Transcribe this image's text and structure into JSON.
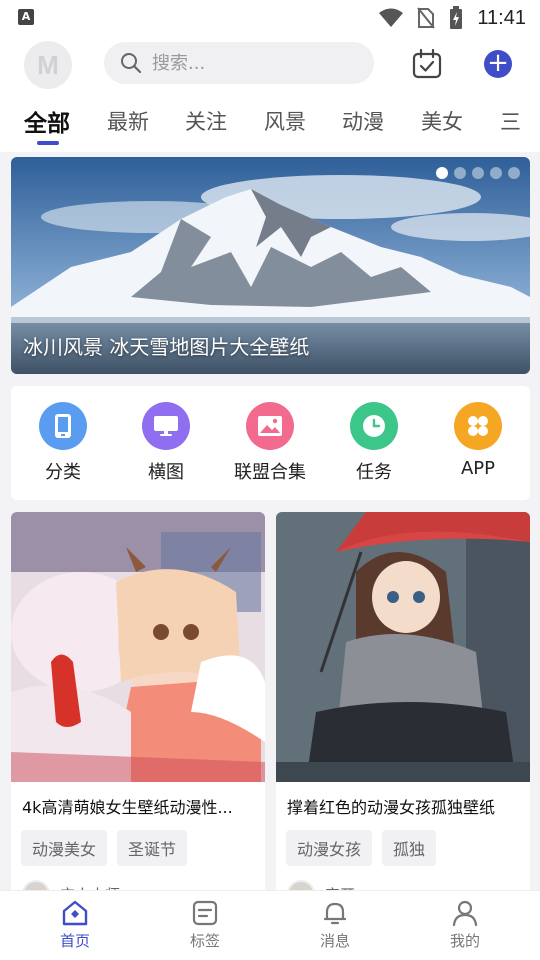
{
  "status_bar": {
    "time": "11:41",
    "left_icon_letter": "A"
  },
  "header": {
    "avatar_letter": "M",
    "search_placeholder": "搜索...",
    "accent": "#3f4dc9"
  },
  "tabs": [
    "全部",
    "最新",
    "关注",
    "风景",
    "动漫",
    "美女",
    "三"
  ],
  "active_tab": "全部",
  "banner": {
    "caption": "冰川风景 冰天雪地图片大全壁纸",
    "slide_count": 5,
    "active_slide": 1
  },
  "quick_nav": [
    {
      "label": "分类",
      "icon": "phone-icon",
      "color": "#5a9cf0"
    },
    {
      "label": "横图",
      "icon": "monitor-icon",
      "color": "#8f6ff0"
    },
    {
      "label": "联盟合集",
      "icon": "image-icon",
      "color": "#f26b8e"
    },
    {
      "label": "任务",
      "icon": "clock-icon",
      "color": "#3cc68a"
    },
    {
      "label": "APP",
      "icon": "grid-icon",
      "color": "#f5a623"
    }
  ],
  "cards": [
    {
      "title": "4k高清萌娘女生壁纸动漫性...",
      "tags": [
        "动漫美女",
        "圣诞节"
      ],
      "author": "宝人大师"
    },
    {
      "title": "撑着红色的动漫女孩孤独壁纸",
      "tags": [
        "动漫女孩",
        "孤独"
      ],
      "author": "审开"
    }
  ],
  "bottom_nav": [
    {
      "label": "首页",
      "icon": "home-icon"
    },
    {
      "label": "标签",
      "icon": "tag-card-icon"
    },
    {
      "label": "消息",
      "icon": "bell-icon"
    },
    {
      "label": "我的",
      "icon": "user-icon"
    }
  ],
  "active_bottom": "首页"
}
